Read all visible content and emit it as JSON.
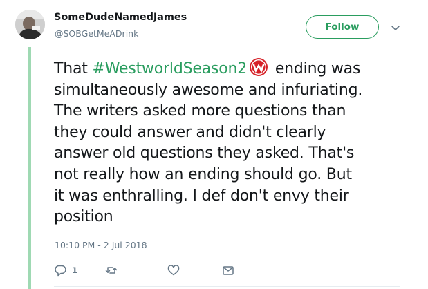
{
  "user": {
    "display_name": "SomeDudeNamedJames",
    "handle": "@SOBGetMeADrink"
  },
  "follow_label": "Follow",
  "tweet": {
    "lines": [
      {
        "pre": "That ",
        "hashtag": "#WestworldSeason2",
        "post": " ending was"
      },
      "simultaneously awesome and infuriating.",
      "The writers asked more questions than",
      "they could answer and didn't clearly",
      "answer old questions they asked. That's",
      "not really how an ending should go. But",
      "it was enthralling. I def don't envy their",
      "position"
    ],
    "timestamp": "10:10 PM - 2 Jul 2018"
  },
  "actions": {
    "reply_count": "1"
  },
  "icons": {
    "avatar": "avatar-photo",
    "caret": "chevron-down-icon",
    "hashflag": "westworld-logo-icon",
    "reply": "reply-icon",
    "retweet": "retweet-icon",
    "like": "heart-icon",
    "dm": "envelope-icon"
  },
  "colors": {
    "accent": "#2a9d5f",
    "thread_line": "#9fd9b3",
    "secondary_text": "#657786",
    "hashflag_red": "#d62128"
  }
}
